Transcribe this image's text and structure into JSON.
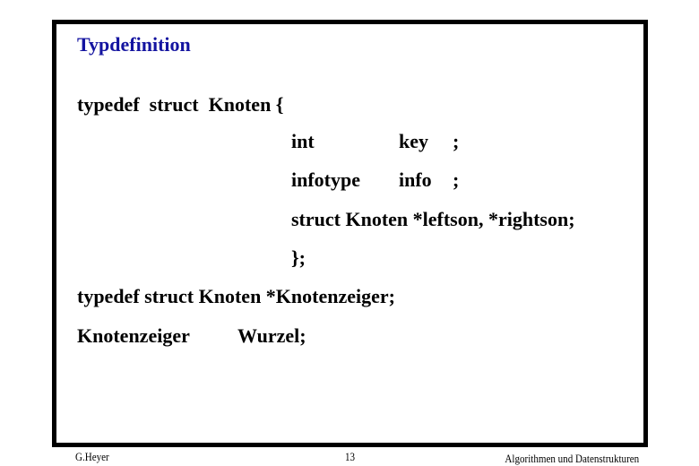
{
  "slide": {
    "title": "Typdefinition",
    "title_color": "#1414a0",
    "code": {
      "line1": "typedef  struct  Knoten {",
      "field1_type": "int",
      "field1_name": "key",
      "field1_semicolon": ";",
      "field2_type": "infotype",
      "field2_name": "info",
      "field2_semicolon": ";",
      "field3": "struct Knoten *leftson, *rightson;",
      "close": "};",
      "line_typedef_ptr": "typedef struct Knoten *Knotenzeiger;",
      "decl_type": "Knotenzeiger",
      "decl_name": "Wurzel;"
    }
  },
  "footer": {
    "author": "G.Heyer",
    "page_number": "13",
    "course": "Algorithmen und Datenstrukturen"
  }
}
